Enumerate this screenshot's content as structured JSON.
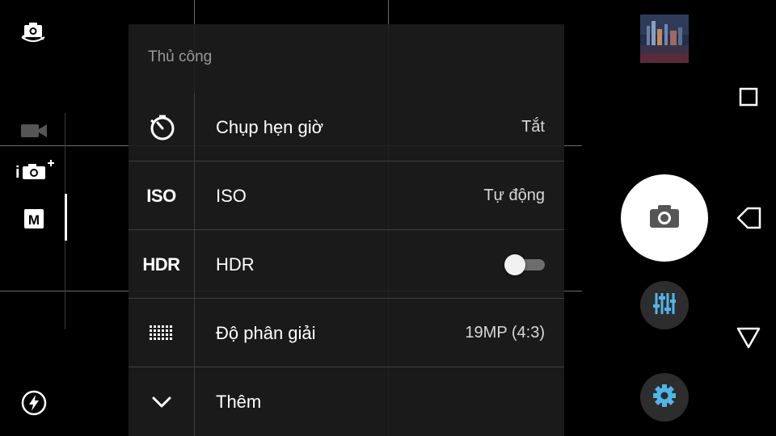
{
  "panel": {
    "title": "Thủ công",
    "rows": [
      {
        "icon": "timer-icon",
        "label": "Chụp hẹn giờ",
        "value": "Tắt"
      },
      {
        "icon": "iso-icon",
        "icon_text": "ISO",
        "label": "ISO",
        "value": "Tự động"
      },
      {
        "icon": "hdr-icon",
        "icon_text": "HDR",
        "label": "HDR",
        "toggle": false
      },
      {
        "icon": "resolution-grid-icon",
        "label": "Độ phân giải",
        "value": "19MP (4:3)"
      },
      {
        "icon": "chevron-down-icon",
        "label": "Thêm"
      }
    ]
  },
  "left_modes": {
    "switch_camera": "switch-camera-icon",
    "video": "video-camera-icon",
    "superior_auto": "camera-plus-icon",
    "superior_auto_text": "i",
    "manual": "manual-mode-icon",
    "manual_text": "M",
    "flash": "flash-auto-icon"
  },
  "right_controls": {
    "gallery": "gallery-thumbnail",
    "shutter": "camera-shutter-icon",
    "adjust": "sliders-icon",
    "settings": "gear-icon",
    "accent": "#4fb6e8"
  },
  "nav": [
    "recents-square-icon",
    "back-triangle-icon",
    "home-triangle-icon"
  ]
}
